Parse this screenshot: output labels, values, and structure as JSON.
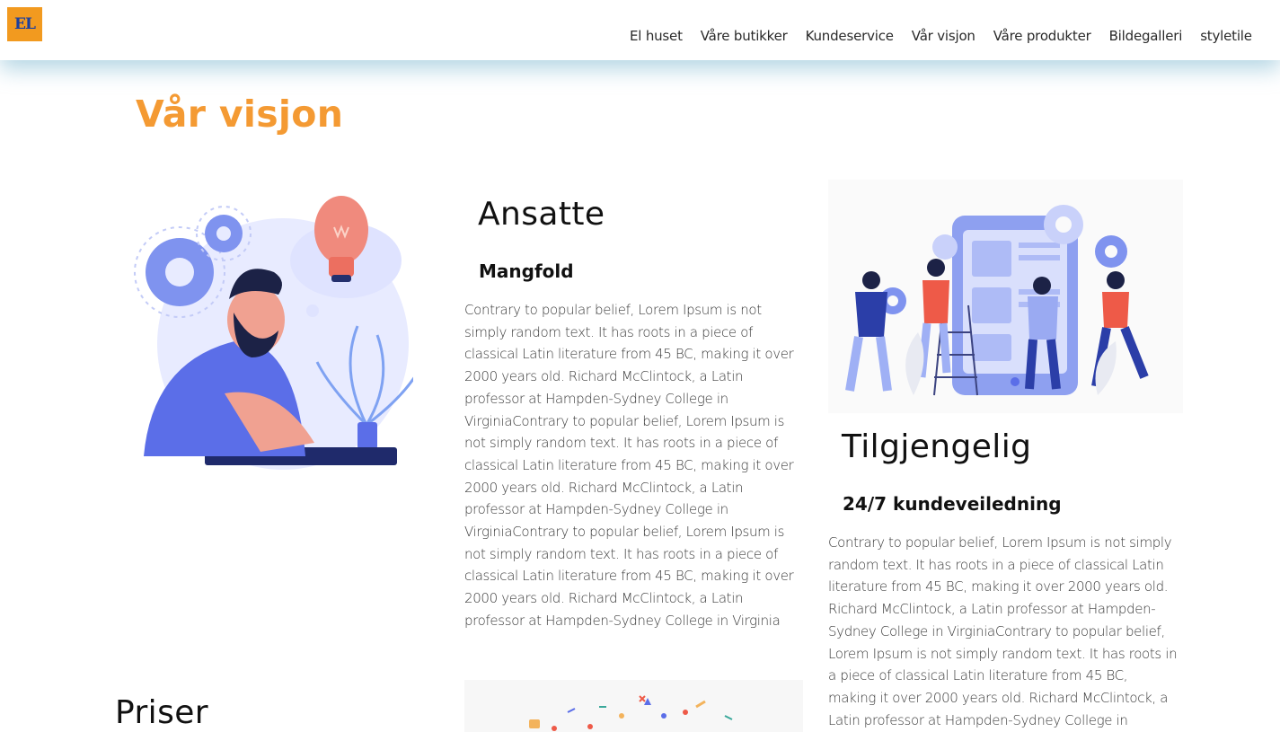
{
  "header": {
    "logo_text": "EL",
    "nav": [
      {
        "label": "El huset"
      },
      {
        "label": "Våre butikker"
      },
      {
        "label": "Kundeservice"
      },
      {
        "label": "Vår visjon"
      },
      {
        "label": "Våre produkter"
      },
      {
        "label": "Bildegalleri"
      },
      {
        "label": "styletile"
      }
    ]
  },
  "page": {
    "title": "Vår visjon"
  },
  "sections": {
    "ansatte": {
      "title": "Ansatte",
      "subtitle": "Mangfold",
      "text": "Contrary to popular belief, Lorem Ipsum is not simply random text. It has roots in a piece of classical Latin literature from 45 BC, making it over 2000 years old. Richard McClintock, a Latin professor at Hampden-Sydney College in VirginiaContrary to popular belief, Lorem Ipsum is not simply random text. It has roots in a piece of classical Latin literature from 45 BC, making it over 2000 years old. Richard McClintock, a Latin professor at Hampden-Sydney College in VirginiaContrary to popular belief, Lorem Ipsum is not simply random text. It has roots in a piece of classical Latin literature from 45 BC, making it over 2000 years old. Richard McClintock, a Latin professor at Hampden-Sydney College in Virginia"
    },
    "tilgjengelig": {
      "title": "Tilgjengelig",
      "subtitle": "24/7 kundeveiledning",
      "text": "Contrary to popular belief, Lorem Ipsum is not simply random text. It has roots in a piece of classical Latin literature from 45 BC, making it over 2000 years old. Richard McClintock, a Latin professor at Hampden-Sydney College in VirginiaContrary to popular belief, Lorem Ipsum is not simply random text. It has roots in a piece of classical Latin literature from 45 BC, making it over 2000 years old. Richard McClintock, a Latin professor at Hampden-Sydney College in Virginia"
    },
    "priser": {
      "title": "Priser"
    }
  },
  "colors": {
    "accent": "#f49a33",
    "logo_bg": "#f29a1f",
    "logo_text": "#1c3f9e",
    "illustration_blue": "#5b6ee8",
    "illustration_light": "#e6eaff",
    "illustration_coral": "#ee6b5d"
  },
  "icons": [
    "thinking-man-illustration",
    "team-app-illustration",
    "bottom-illustration"
  ]
}
